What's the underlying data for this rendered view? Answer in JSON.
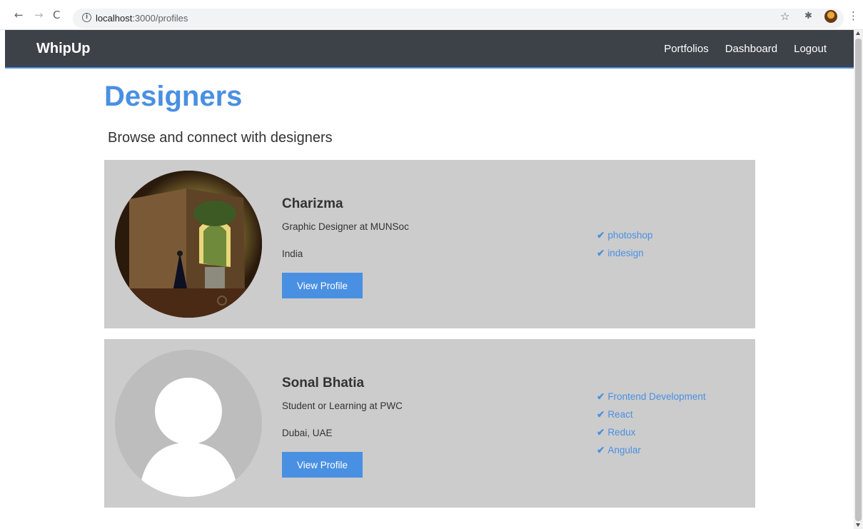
{
  "browser": {
    "url_host": "localhost",
    "url_path": ":3000/profiles",
    "back": "←",
    "forward": "→",
    "reload": "C",
    "star": "☆",
    "extensions": "✱",
    "menu": "⋮"
  },
  "nav": {
    "brand": "WhipUp",
    "links": [
      "Portfolios",
      "Dashboard",
      "Logout"
    ]
  },
  "page": {
    "title": "Designers",
    "lead": "Browse and connect with designers"
  },
  "profiles": [
    {
      "name": "Charizma",
      "role": "Graphic Designer at MUNSoc",
      "location": "India",
      "button": "View Profile",
      "skills": [
        "photoshop",
        "indesign"
      ]
    },
    {
      "name": "Sonal Bhatia",
      "role": "Student or Learning at PWC",
      "location": "Dubai, UAE",
      "button": "View Profile",
      "skills": [
        "Frontend Development",
        "React",
        "Redux",
        "Angular"
      ]
    }
  ],
  "colors": {
    "accent": "#4a90e2",
    "navbar": "#3d4148",
    "card": "#cccccc"
  }
}
